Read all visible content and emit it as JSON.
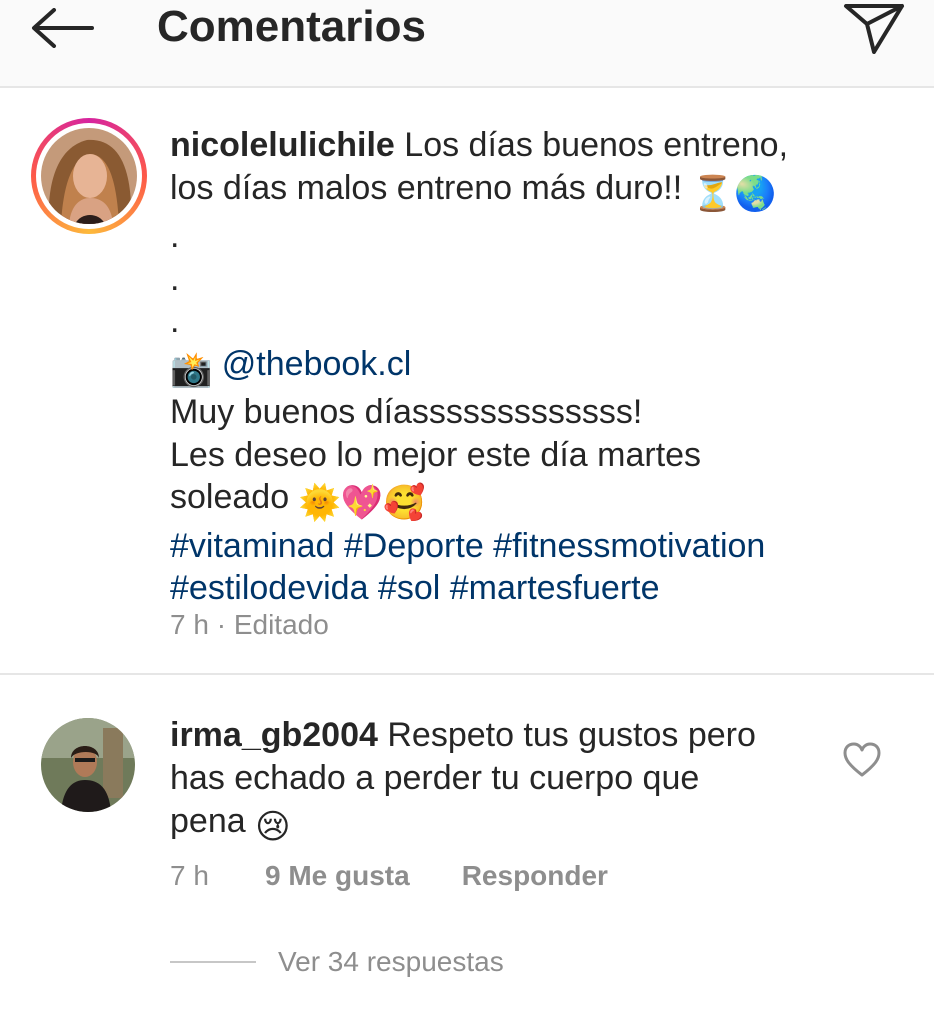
{
  "header": {
    "title": "Comentarios",
    "back_icon": "arrow-left-icon",
    "send_icon": "paper-plane-icon"
  },
  "caption": {
    "username": "nicolelulichile",
    "line1": " Los días buenos entreno,",
    "line2": "los días malos entreno más duro!! ",
    "dot1": ".",
    "dot2": ".",
    "dot3": ".",
    "camera_emoji": "📸",
    "mention": "@thebook.cl",
    "line_greeting": "Muy buenos díasssssssssssss!",
    "line_wish1": "Les deseo lo mejor este día martes",
    "line_wish2": "soleado ",
    "hashtags_line1": "#vitaminad #Deporte #fitnessmotivation",
    "hashtags_line2": "#estilodevida #sol #martesfuerte",
    "emoji_hourglass": "⏳",
    "emoji_globe": "🌏",
    "emoji_sun": "🌞",
    "emoji_heart": "💖",
    "emoji_love": "🥰",
    "timestamp": "7 h",
    "separator": " · ",
    "edited": "Editado"
  },
  "comment": {
    "username": "irma_gb2004",
    "line1": " Respeto tus gustos pero",
    "line2": "has echado a perder tu cuerpo que",
    "line3": "pena ",
    "emoji_sad": "😢",
    "timestamp": "7 h",
    "likes": "9 Me gusta",
    "reply": "Responder",
    "view_replies": "Ver 34 respuestas"
  },
  "colors": {
    "text": "#262626",
    "muted": "#8e8e8e",
    "link": "#003569",
    "divider": "#e6e6e6",
    "header_bg": "#fafafa"
  }
}
